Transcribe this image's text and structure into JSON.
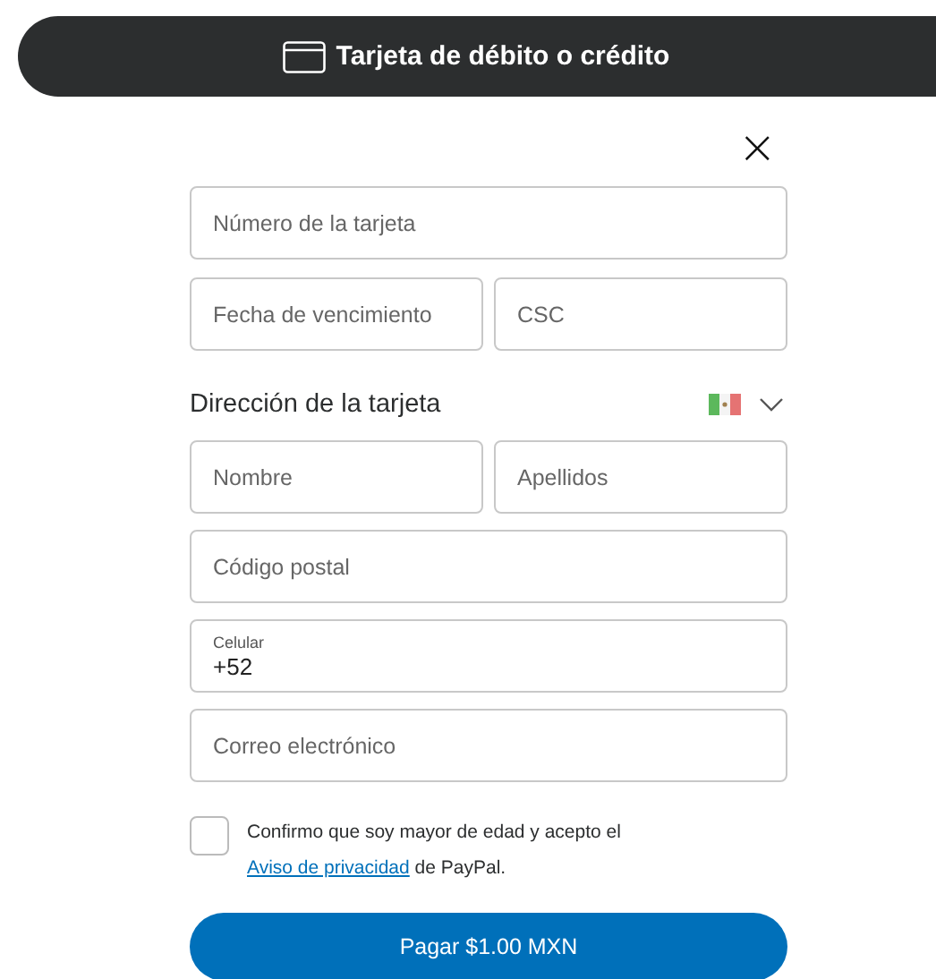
{
  "header": {
    "title": "Tarjeta de débito o crédito"
  },
  "close": {
    "label": "×"
  },
  "card_fields": [
    {
      "placeholder": "Número de la tarjeta"
    },
    {
      "placeholder": "Fecha de vencimiento"
    },
    {
      "placeholder": "CSC"
    }
  ],
  "address": {
    "heading": "Dirección de la tarjeta"
  },
  "address_fields": [
    {
      "kind": "input",
      "placeholder": "Nombre"
    },
    {
      "kind": "input",
      "placeholder": "Apellidos"
    },
    {
      "kind": "input",
      "placeholder": "Código postal"
    },
    {
      "kind": "labeled",
      "label": "Celular",
      "value": "+52"
    },
    {
      "kind": "input",
      "placeholder": "Correo electrónico"
    }
  ],
  "consent": {
    "checked": false,
    "text_before": "Confirmo que soy mayor de edad y acepto el",
    "link": "Aviso de privacidad",
    "text_after": "de PayPal."
  },
  "pay_button": {
    "label": "Pagar $1.00 MXN"
  }
}
